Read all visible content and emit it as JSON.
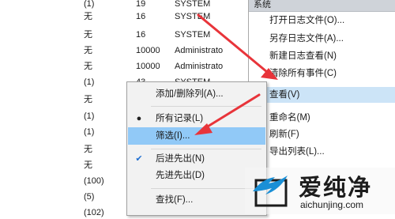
{
  "event_rows": [
    {
      "col1": "(1)",
      "col2": "19",
      "col3": "SYSTEM"
    },
    {
      "col1": "无",
      "col2": "16",
      "col3": "SYSTEM"
    },
    {
      "col1": "无",
      "col2": "16",
      "col3": "SYSTEM"
    },
    {
      "col1": "无",
      "col2": "10000",
      "col3": "Administrato"
    },
    {
      "col1": "无",
      "col2": "10000",
      "col3": "Administrato"
    },
    {
      "col1": "(1)",
      "col2": "43",
      "col3": "SYSTEM"
    },
    {
      "col1": "无",
      "col2": "",
      "col3": ""
    },
    {
      "col1": "(1)",
      "col2": "",
      "col3": ""
    },
    {
      "col1": "(1)",
      "col2": "",
      "col3": ""
    },
    {
      "col1": "无",
      "col2": "",
      "col3": ""
    },
    {
      "col1": "无",
      "col2": "",
      "col3": ""
    },
    {
      "col1": "(100)",
      "col2": "",
      "col3": ""
    },
    {
      "col1": "(5)",
      "col2": "",
      "col3": ""
    },
    {
      "col1": "(102)",
      "col2": "",
      "col3": ""
    }
  ],
  "action_pane": {
    "header": "系统",
    "items": [
      {
        "label": "打开日志文件(O)..."
      },
      {
        "label": "另存日志文件(A)..."
      },
      {
        "label": "新建日志查看(N)"
      },
      {
        "label": "清除所有事件(C)"
      },
      {
        "label": "查看(V)"
      },
      {
        "label": "重命名(M)"
      },
      {
        "label": "刷新(F)"
      },
      {
        "label": "导出列表(L)..."
      }
    ]
  },
  "context_menu": {
    "items": [
      {
        "label": "添加/删除列(A)...",
        "mark": ""
      },
      {
        "label": "所有记录(L)",
        "mark": "●"
      },
      {
        "label": "筛选(I)...",
        "mark": ""
      },
      {
        "label": "后进先出(N)",
        "mark": "✔"
      },
      {
        "label": "先进先出(D)",
        "mark": ""
      },
      {
        "label": "查找(F)...",
        "mark": ""
      }
    ]
  },
  "watermark": {
    "brand_cn": "爱纯净",
    "domain": "aichunjing.com"
  },
  "colors": {
    "arrow": "#e8343a",
    "menu_highlight": "#91c9f7",
    "pane_highlight": "#cce4f7"
  }
}
